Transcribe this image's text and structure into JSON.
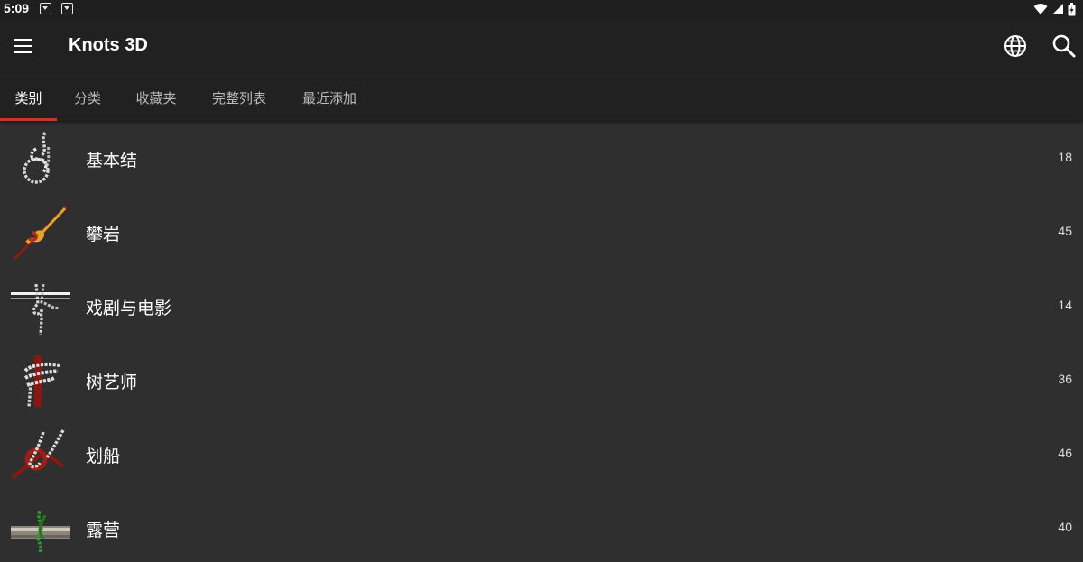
{
  "status_bar": {
    "time": "5:09"
  },
  "app_bar": {
    "title": "Knots 3D"
  },
  "tabs": [
    {
      "label": "类别"
    },
    {
      "label": "分类"
    },
    {
      "label": "收藏夹"
    },
    {
      "label": "完整列表"
    },
    {
      "label": "最近添加"
    }
  ],
  "categories": [
    {
      "label": "基本结",
      "count": "18",
      "icon": "basic-knot-icon"
    },
    {
      "label": "攀岩",
      "count": "45",
      "icon": "climbing-knot-icon"
    },
    {
      "label": "戏剧与电影",
      "count": "14",
      "icon": "theatre-knot-icon"
    },
    {
      "label": "树艺师",
      "count": "36",
      "icon": "arborist-knot-icon"
    },
    {
      "label": "划船",
      "count": "46",
      "icon": "boating-knot-icon"
    },
    {
      "label": "露营",
      "count": "40",
      "icon": "camping-knot-icon"
    }
  ],
  "colors": {
    "background": "#2f2f2f",
    "app_bar": "#212121",
    "tab_indicator": "#c0392b"
  }
}
